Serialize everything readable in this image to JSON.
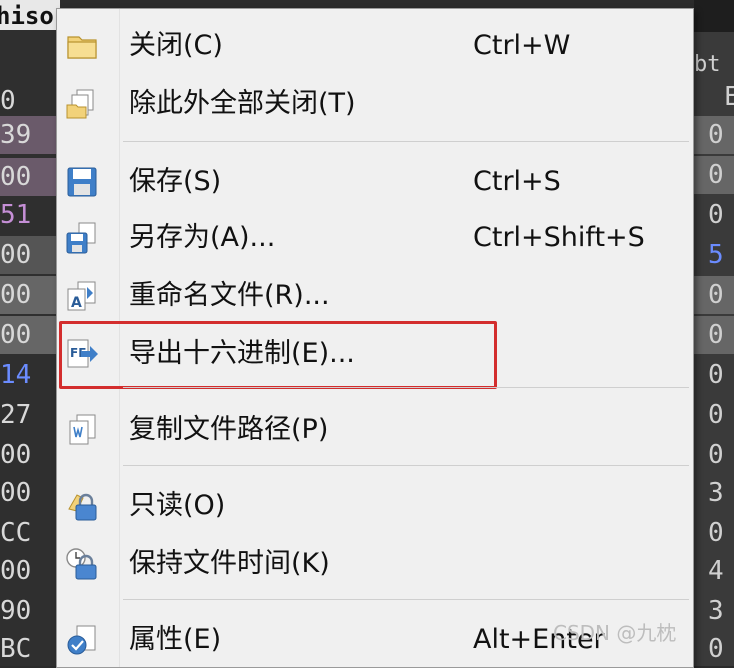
{
  "background": {
    "title_fragment": "hiso",
    "right_header_fragment": "bt",
    "left_offsets": [
      "0",
      "39",
      "00",
      "51",
      "00",
      "00",
      "00",
      "14",
      "27",
      "00",
      "00",
      "CC",
      "00",
      "90",
      "BC"
    ],
    "right_hex": [
      "E",
      "0",
      "0",
      "0",
      "5",
      "0",
      "0",
      "0",
      "0",
      "0",
      "3",
      "0",
      "4",
      "3",
      "0"
    ]
  },
  "menu": {
    "items": [
      {
        "label": "关闭(C)",
        "shortcut": "Ctrl+W",
        "icon": "folder-icon"
      },
      {
        "label": "除此外全部关闭(T)",
        "shortcut": "",
        "icon": "documents-icon"
      },
      {
        "label": "保存(S)",
        "shortcut": "Ctrl+S",
        "icon": "save-icon"
      },
      {
        "label": "另存为(A)...",
        "shortcut": "Ctrl+Shift+S",
        "icon": "save-as-icon"
      },
      {
        "label": "重命名文件(R)...",
        "shortcut": "",
        "icon": "rename-icon"
      },
      {
        "label": "导出十六进制(E)...",
        "shortcut": "",
        "icon": "export-hex-icon"
      },
      {
        "label": "复制文件路径(P)",
        "shortcut": "",
        "icon": "copy-path-icon"
      },
      {
        "label": "只读(O)",
        "shortcut": "",
        "icon": "lock-icon"
      },
      {
        "label": "保持文件时间(K)",
        "shortcut": "",
        "icon": "clock-lock-icon"
      },
      {
        "label": "属性(E)",
        "shortcut": "Alt+Enter",
        "icon": "properties-icon"
      }
    ],
    "highlighted_item": "导出十六进制(E)..."
  },
  "watermark": "CSDN @九枕",
  "colors": {
    "highlight_border": "#d32d2d",
    "menu_bg": "#f0f0f0"
  }
}
